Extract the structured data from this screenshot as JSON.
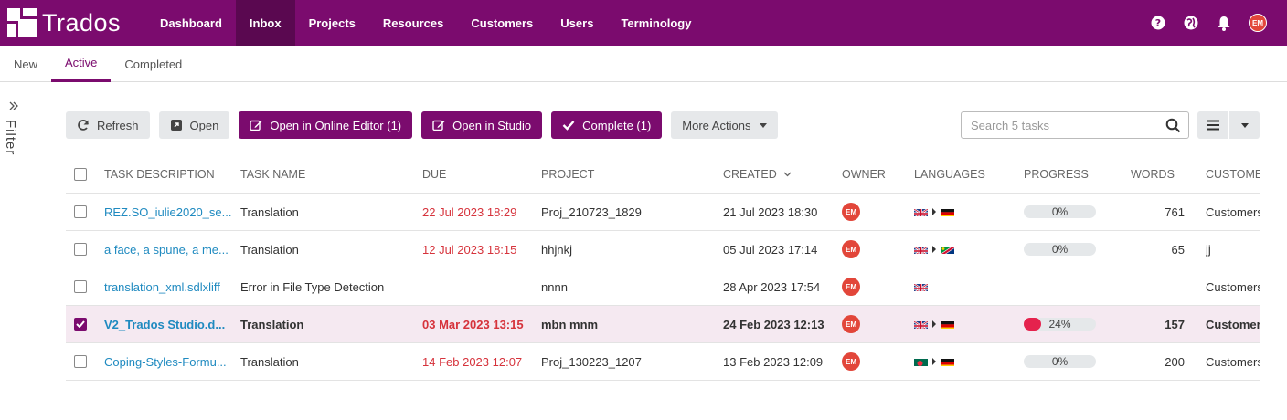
{
  "app": {
    "name": "Trados"
  },
  "nav": {
    "items": [
      "Dashboard",
      "Inbox",
      "Projects",
      "Resources",
      "Customers",
      "Users",
      "Terminology"
    ],
    "active": "Inbox"
  },
  "user": {
    "initials": "EM"
  },
  "subtabs": {
    "items": [
      "New",
      "Active",
      "Completed"
    ],
    "active": "Active"
  },
  "filter": {
    "label": "Filter"
  },
  "toolbar": {
    "refresh": "Refresh",
    "open": "Open",
    "open_online_editor": "Open in Online Editor (1)",
    "open_studio": "Open in Studio",
    "complete": "Complete (1)",
    "more_actions": "More Actions"
  },
  "search": {
    "placeholder": "Search 5 tasks"
  },
  "columns": {
    "task_description": "TASK DESCRIPTION",
    "task_name": "TASK NAME",
    "due": "DUE",
    "project": "PROJECT",
    "created": "CREATED",
    "owner": "OWNER",
    "languages": "LANGUAGES",
    "progress": "PROGRESS",
    "words": "WORDS",
    "customer": "CUSTOMER"
  },
  "rows": [
    {
      "desc": "REZ.SO_iulie2020_se...",
      "name": "Translation",
      "due": "22 Jul 2023 18:29",
      "project": "Proj_210723_1829",
      "created": "21 Jul 2023 18:30",
      "owner": "EM",
      "source_flag": "gb",
      "target_flag": "de",
      "progress": "0%",
      "progress_value": 0,
      "words": "761",
      "customer": "Customers",
      "selected": false
    },
    {
      "desc": "a face, a spune, a me...",
      "name": "Translation",
      "due": "12 Jul 2023 18:15",
      "project": "hhjnkj",
      "created": "05 Jul 2023 17:14",
      "owner": "EM",
      "source_flag": "gb",
      "target_flag": "na",
      "progress": "0%",
      "progress_value": 0,
      "words": "65",
      "customer": "jj",
      "selected": false
    },
    {
      "desc": "translation_xml.sdlxliff",
      "name": "Error in File Type Detection",
      "due": "",
      "project": "nnnn",
      "created": "28 Apr 2023 17:54",
      "owner": "EM",
      "source_flag": "gb",
      "target_flag": "",
      "progress": "",
      "progress_value": null,
      "words": "",
      "customer": "Customers",
      "selected": false
    },
    {
      "desc": "V2_Trados Studio.d...",
      "name": "Translation",
      "due": "03 Mar 2023 13:15",
      "project": "mbn mnm",
      "created": "24 Feb 2023 12:13",
      "owner": "EM",
      "source_flag": "gb",
      "target_flag": "de",
      "progress": "24%",
      "progress_value": 24,
      "words": "157",
      "customer": "Customers",
      "selected": true
    },
    {
      "desc": "Coping-Styles-Formu...",
      "name": "Translation",
      "due": "14 Feb 2023 12:07",
      "project": "Proj_130223_1207",
      "created": "13 Feb 2023 12:09",
      "owner": "EM",
      "source_flag": "bd",
      "target_flag": "de",
      "progress": "0%",
      "progress_value": 0,
      "words": "200",
      "customer": "Customers",
      "selected": false
    }
  ],
  "colors": {
    "brand": "#7b0b6e",
    "nav_active": "#5a0850",
    "link": "#1f8ac0",
    "due": "#d6333c",
    "owner_badge": "#e2463a",
    "progress_fill": "#e5224d",
    "selected_row": "#f5e9f1"
  }
}
